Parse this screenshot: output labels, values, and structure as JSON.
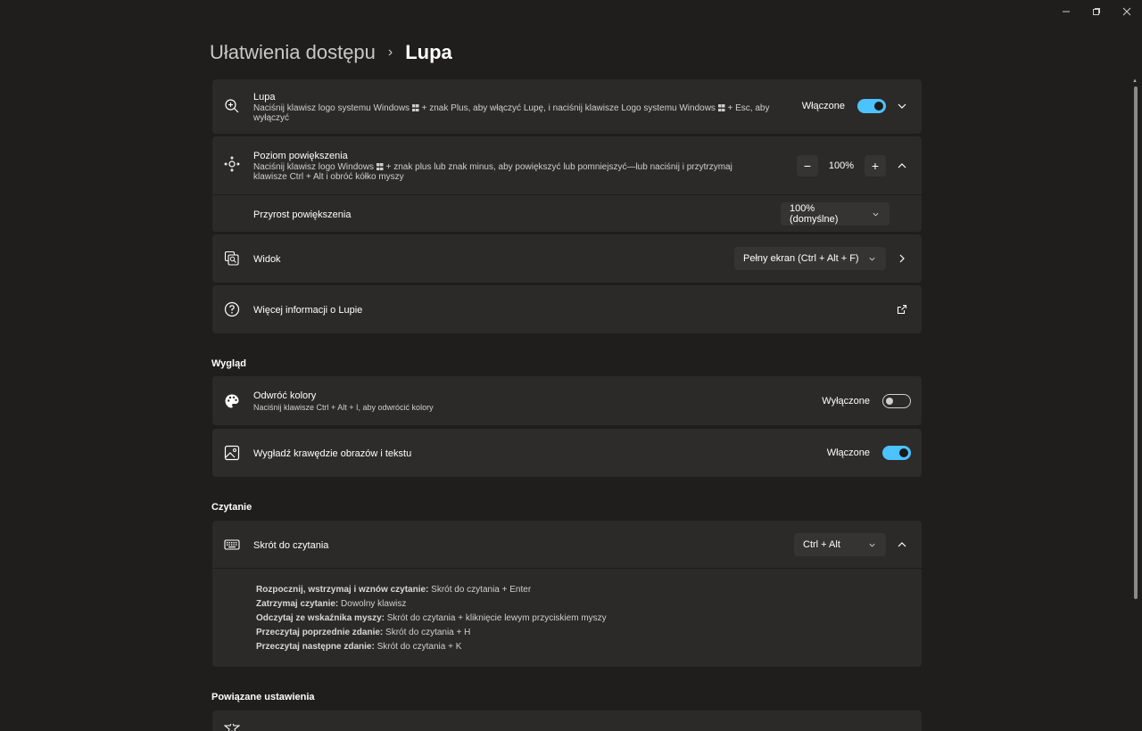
{
  "window": {
    "minimize_icon": "minimize-icon",
    "maximize_icon": "restore-icon",
    "close_icon": "close-icon"
  },
  "breadcrumb": {
    "parent": "Ułatwienia dostępu",
    "separator": "›",
    "current": "Lupa"
  },
  "lupa": {
    "title": "Lupa",
    "desc_part1": "Naciśnij klawisz logo systemu Windows",
    "desc_part2": "+ znak Plus, aby włączyć Lupę, i naciśnij klawisze Logo systemu Windows",
    "desc_part3": "+ Esc, aby wyłączyć",
    "state": "Włączone",
    "toggle_on": true
  },
  "zoom": {
    "title": "Poziom powiększenia",
    "desc_part1": "Naciśnij klawisz logo Windows",
    "desc_part2": "+ znak plus lub znak minus, aby powiększyć lub pomniejszyć—lub naciśnij i przytrzymaj klawisze Ctrl + Alt i obróć kółko myszy",
    "minus": "−",
    "value": "100%",
    "plus": "+",
    "increment_label": "Przyrost powiększenia",
    "increment_value": "100% (domyślne)"
  },
  "view": {
    "title": "Widok",
    "value": "Pełny ekran (Ctrl + Alt + F)"
  },
  "more_info": {
    "title": "Więcej informacji o Lupie"
  },
  "appearance": {
    "section": "Wygląd",
    "invert": {
      "title": "Odwróć kolory",
      "desc": "Naciśnij klawisze Ctrl + Alt + I, aby odwrócić kolory",
      "state": "Wyłączone",
      "toggle_on": false
    },
    "smooth": {
      "title": "Wygładź krawędzie obrazów i tekstu",
      "state": "Włączone",
      "toggle_on": true
    }
  },
  "reading": {
    "section": "Czytanie",
    "shortcut_title": "Skrót do czytania",
    "shortcut_value": "Ctrl + Alt",
    "items": [
      {
        "bold": "Rozpocznij, wstrzymaj i wznów czytanie:",
        "text": " Skrót do czytania + Enter"
      },
      {
        "bold": "Zatrzymaj czytanie:",
        "text": " Dowolny klawisz"
      },
      {
        "bold": "Odczytaj ze wskaźnika myszy:",
        "text": " Skrót do czytania + kliknięcie lewym przyciskiem myszy"
      },
      {
        "bold": "Przeczytaj poprzednie zdanie:",
        "text": " Skrót do czytania + H"
      },
      {
        "bold": "Przeczytaj następne zdanie:",
        "text": " Skrót do czytania + K"
      }
    ]
  },
  "related": {
    "section": "Powiązane ustawienia"
  },
  "colors": {
    "accent": "#4cc2ff",
    "background": "#1f1e1d",
    "card": "#2b2a29"
  }
}
